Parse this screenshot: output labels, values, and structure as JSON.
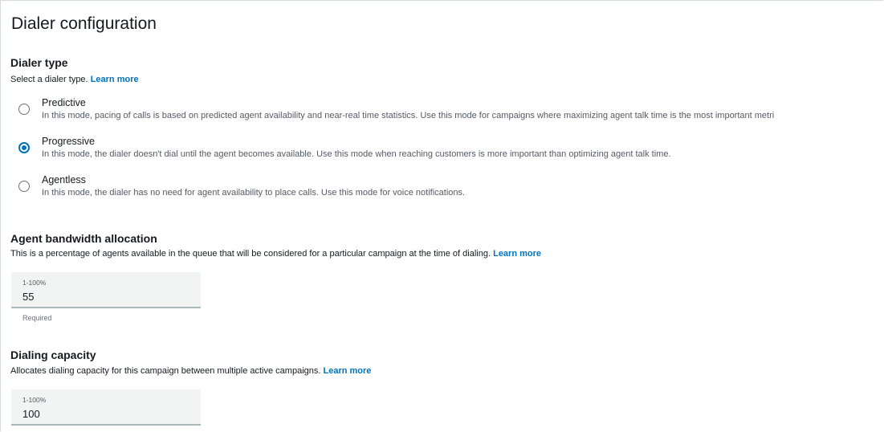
{
  "title": "Dialer configuration",
  "dialer_type": {
    "heading": "Dialer type",
    "description": "Select a dialer type.",
    "learn_more": "Learn more",
    "options": [
      {
        "label": "Predictive",
        "description": "In this mode, pacing of calls is based on predicted agent availability and near-real time statistics. Use this mode for campaigns where maximizing agent talk time is the most important metri",
        "selected": false
      },
      {
        "label": "Progressive",
        "description": "In this mode, the dialer doesn't dial until the agent becomes available. Use this mode when reaching customers is more important than optimizing agent talk time.",
        "selected": true
      },
      {
        "label": "Agentless",
        "description": "In this mode, the dialer has no need for agent availability to place calls. Use this mode for voice notifications.",
        "selected": false
      }
    ]
  },
  "agent_bandwidth": {
    "heading": "Agent bandwidth allocation",
    "description": "This is a percentage of agents available in the queue that will be considered for a particular campaign at the time of dialing.",
    "learn_more": "Learn more",
    "placeholder": "1-100%",
    "value": "55",
    "constraint": "Required"
  },
  "dialing_capacity": {
    "heading": "Dialing capacity",
    "description": "Allocates dialing capacity for this campaign between multiple active campaigns.",
    "learn_more": "Learn more",
    "placeholder": "1-100%",
    "value": "100"
  },
  "colors": {
    "accent": "#0073bb",
    "text": "#16191f",
    "field_bg": "#f2f3f3"
  }
}
